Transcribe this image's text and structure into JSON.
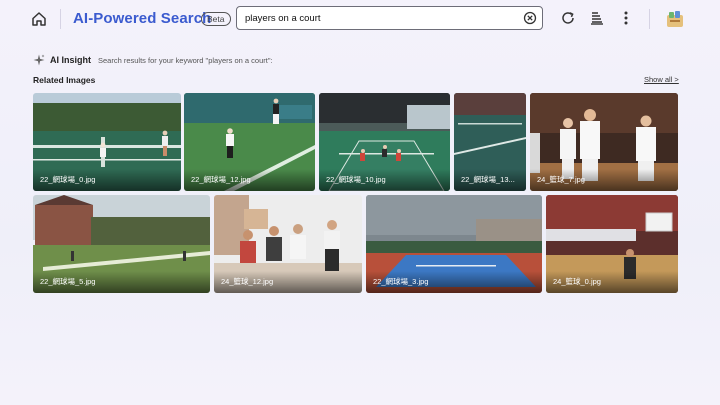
{
  "header": {
    "title": "AI-Powered Search",
    "badge": "Beta",
    "icons": [
      "home-icon",
      "refresh-icon",
      "clean-icon",
      "more-vertical-icon",
      "app-avatar-icon"
    ]
  },
  "search": {
    "value": "players on a court",
    "clear_icon": "clear-circle-icon"
  },
  "insight": {
    "label": "AI Insight",
    "text": "Search results for your keyword \"players on a court\":",
    "icon": "sparkle-icon"
  },
  "related": {
    "title": "Related Images",
    "show_all": "Show all >",
    "images": [
      {
        "caption": "22_網球場_0.jpg"
      },
      {
        "caption": "22_網球場_12.jpg"
      },
      {
        "caption": "22_網球場_10.jpg"
      },
      {
        "caption": "22_網球場_13..."
      },
      {
        "caption": "24_籃球_7.jpg"
      },
      {
        "caption": "22_網球場_5.jpg"
      },
      {
        "caption": "24_籃球_12.jpg"
      },
      {
        "caption": "22_網球場_3.jpg"
      },
      {
        "caption": "24_籃球_0.jpg"
      }
    ]
  },
  "colors": {
    "accent": "#3b5bcf",
    "background": "#f2f0fa"
  }
}
